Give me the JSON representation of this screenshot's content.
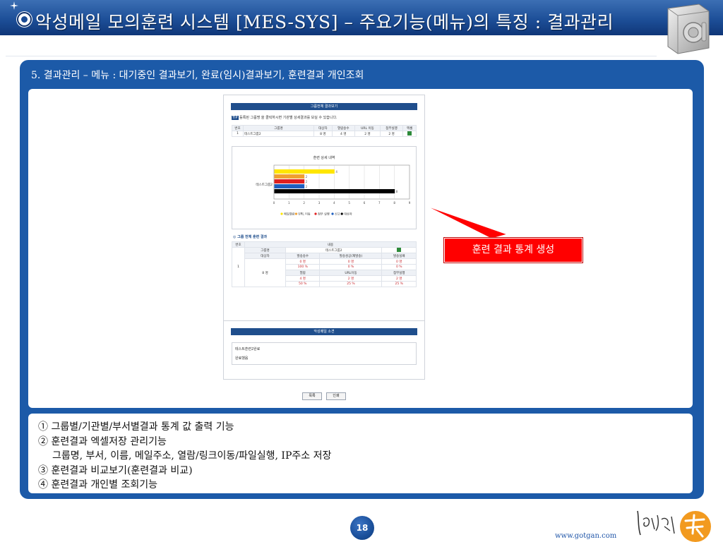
{
  "header": {
    "title": "악성메일 모의훈련 시스템 [MES-SYS] – 주요기능(메뉴)의 특징 : 결과관리"
  },
  "section": {
    "title": "5. 결과관리 – 메뉴 : 대기중인 결과보기, 완료(임시)결과보기, 훈련결과 개인조회"
  },
  "mini_screen": {
    "title_bar": "그룹전체 결과보기",
    "tip_badge": "TIP",
    "tip_text": "등록된 그룹명 을 클릭하시면 기관별 상세결과를 보실 수 있습니다.",
    "group_table": {
      "headers": [
        "번호",
        "그룹명",
        "대상자",
        "열람송수",
        "URL 이동",
        "첨부실행",
        "엑셀"
      ],
      "rows": [
        [
          "1",
          "테스트그룹2",
          "8 명",
          "4 명",
          "2 명",
          "2 명",
          ""
        ]
      ]
    },
    "chart": {
      "title": "훈련 상세 내역",
      "category_label": "테스트그룹2",
      "legend": [
        "메일열람",
        "URL 이동",
        "첨부 실행",
        "신고",
        "대상자"
      ]
    },
    "chart_data": {
      "type": "bar",
      "categories": [
        "테스트그룹2"
      ],
      "series": [
        {
          "name": "메일열람",
          "values": [
            4
          ],
          "color": "#ffe600"
        },
        {
          "name": "URL 이동",
          "values": [
            2
          ],
          "color": "#f0a030"
        },
        {
          "name": "첨부 실행",
          "values": [
            2
          ],
          "color": "#e02020"
        },
        {
          "name": "신고",
          "values": [
            2
          ],
          "color": "#1f5fbf"
        },
        {
          "name": "대상자",
          "values": [
            8
          ],
          "color": "#000000"
        }
      ],
      "data_labels": [
        "4",
        "2",
        "2",
        "2",
        "8"
      ],
      "xlim": [
        0,
        9
      ],
      "x_ticks": [
        "0",
        "1",
        "2",
        "3",
        "4",
        "5",
        "6",
        "7",
        "8",
        "9"
      ],
      "orientation": "horizontal",
      "grid": true,
      "legend_position": "bottom"
    },
    "detail_section_title": "그룹 전체 훈련 결과",
    "detail_table": {
      "col_headers": [
        "번호",
        "내용"
      ],
      "group_label": "그룹명",
      "group_value": "테스트그룹2",
      "row_no": "1",
      "target_count": "8 명",
      "sub_headers_1": [
        "대상자",
        "발송송수",
        "발송성공(재발송)",
        "발송실패"
      ],
      "values_1": [
        "0 명",
        "0 명",
        "0 명"
      ],
      "pct_1": [
        "100 %",
        "0 %",
        "0 %"
      ],
      "sub_headers_2": [
        "열람",
        "URL이동",
        "첨부실행"
      ],
      "values_2": [
        "4 명",
        "2 명",
        "2 명"
      ],
      "pct_2": [
        "50 %",
        "25 %",
        "25 %"
      ]
    },
    "note_title": "악성메일 소견",
    "note_lines": [
      "테스트훈련2완료",
      "완료했음"
    ],
    "buttons": [
      "목록",
      "인쇄"
    ]
  },
  "callout": {
    "text": "훈련 결과 통계 생성",
    "fill_color": "#ff0000"
  },
  "description": {
    "lines": [
      "① 그룹별/기관별/부서별결과 통계 값 출력 기능",
      "② 훈련결과 엑셀저장 관리기능",
      "그룹명, 부서, 이름, 메일주소, 열람/링크이동/파일실행, IP주소 저장",
      "③ 훈련결과 비교보기(훈련결과 비교)",
      "④ 훈련결과 개인별 조회기능"
    ]
  },
  "footer": {
    "page_number": "18",
    "url": "www.gotgan.com"
  },
  "colors": {
    "panel_blue": "#1c5aa8",
    "header_blue": "#1d4f98",
    "accent_red": "#ff0000"
  }
}
